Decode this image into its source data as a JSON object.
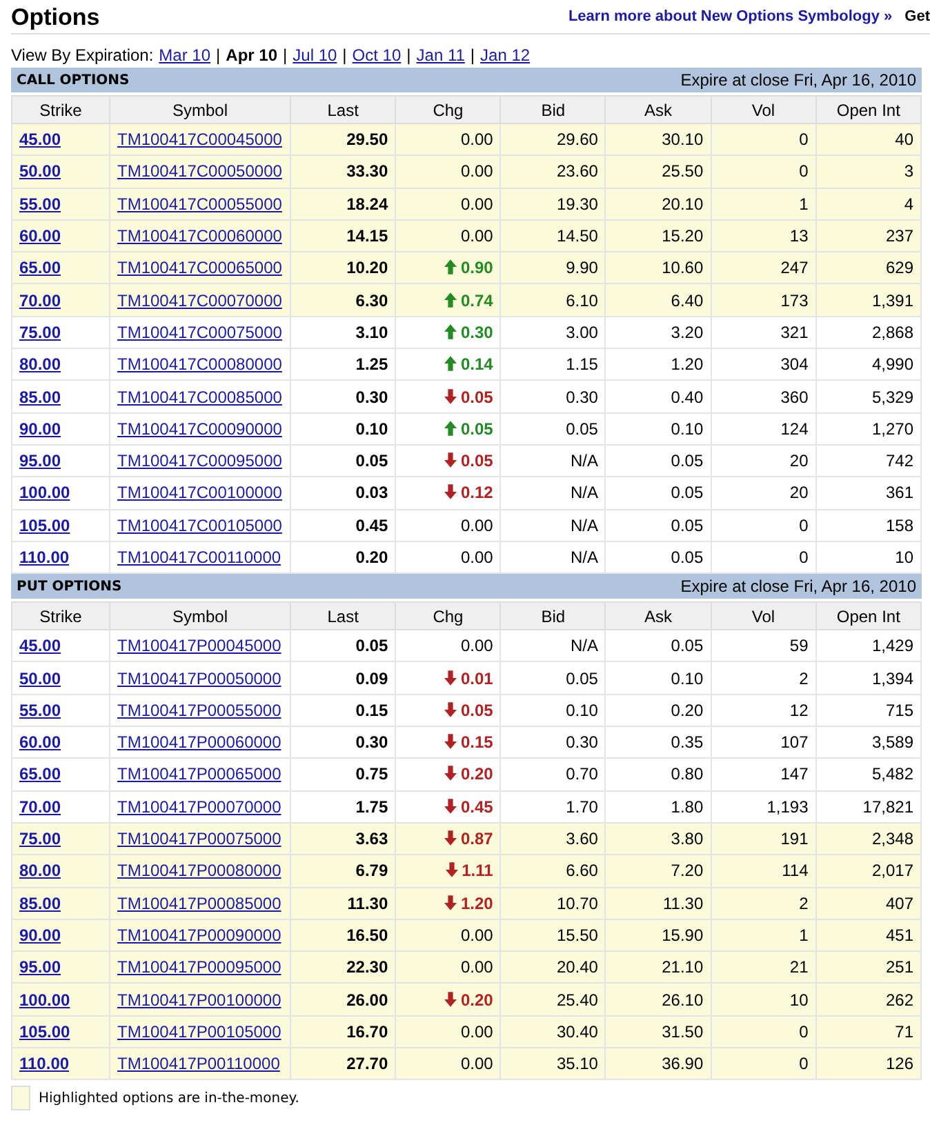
{
  "page_title": "Options",
  "symbology_link": "Learn more about New Options Symbology »",
  "get_link": "Get",
  "expiration": {
    "label": "View By Expiration:",
    "separator": "|",
    "options": [
      {
        "label": "Mar 10",
        "selected": false
      },
      {
        "label": "Apr 10",
        "selected": true
      },
      {
        "label": "Jul 10",
        "selected": false
      },
      {
        "label": "Oct 10",
        "selected": false
      },
      {
        "label": "Jan 11",
        "selected": false
      },
      {
        "label": "Jan 12",
        "selected": false
      }
    ]
  },
  "tables": [
    {
      "title": "CALL OPTIONS",
      "expire": "Expire at close Fri, Apr 16, 2010",
      "columns": [
        "Strike",
        "Symbol",
        "Last",
        "Chg",
        "Bid",
        "Ask",
        "Vol",
        "Open Int"
      ],
      "rows": [
        {
          "strike": "45.00",
          "symbol": "TM100417C00045000",
          "last": "29.50",
          "change": "0.00",
          "kind": "flat",
          "bid": "29.60",
          "ask": "30.10",
          "vol": "0",
          "open_int": "40",
          "in_the_money": true
        },
        {
          "strike": "50.00",
          "symbol": "TM100417C00050000",
          "last": "33.30",
          "change": "0.00",
          "kind": "flat",
          "bid": "23.60",
          "ask": "25.50",
          "vol": "0",
          "open_int": "3",
          "in_the_money": true
        },
        {
          "strike": "55.00",
          "symbol": "TM100417C00055000",
          "last": "18.24",
          "change": "0.00",
          "kind": "flat",
          "bid": "19.30",
          "ask": "20.10",
          "vol": "1",
          "open_int": "4",
          "in_the_money": true
        },
        {
          "strike": "60.00",
          "symbol": "TM100417C00060000",
          "last": "14.15",
          "change": "0.00",
          "kind": "flat",
          "bid": "14.50",
          "ask": "15.20",
          "vol": "13",
          "open_int": "237",
          "in_the_money": true
        },
        {
          "strike": "65.00",
          "symbol": "TM100417C00065000",
          "last": "10.20",
          "change": "0.90",
          "kind": "up",
          "bid": "9.90",
          "ask": "10.60",
          "vol": "247",
          "open_int": "629",
          "in_the_money": true
        },
        {
          "strike": "70.00",
          "symbol": "TM100417C00070000",
          "last": "6.30",
          "change": "0.74",
          "kind": "up",
          "bid": "6.10",
          "ask": "6.40",
          "vol": "173",
          "open_int": "1,391",
          "in_the_money": true
        },
        {
          "strike": "75.00",
          "symbol": "TM100417C00075000",
          "last": "3.10",
          "change": "0.30",
          "kind": "up",
          "bid": "3.00",
          "ask": "3.20",
          "vol": "321",
          "open_int": "2,868",
          "in_the_money": false
        },
        {
          "strike": "80.00",
          "symbol": "TM100417C00080000",
          "last": "1.25",
          "change": "0.14",
          "kind": "up",
          "bid": "1.15",
          "ask": "1.20",
          "vol": "304",
          "open_int": "4,990",
          "in_the_money": false
        },
        {
          "strike": "85.00",
          "symbol": "TM100417C00085000",
          "last": "0.30",
          "change": "0.05",
          "kind": "down",
          "bid": "0.30",
          "ask": "0.40",
          "vol": "360",
          "open_int": "5,329",
          "in_the_money": false
        },
        {
          "strike": "90.00",
          "symbol": "TM100417C00090000",
          "last": "0.10",
          "change": "0.05",
          "kind": "up",
          "bid": "0.05",
          "ask": "0.10",
          "vol": "124",
          "open_int": "1,270",
          "in_the_money": false
        },
        {
          "strike": "95.00",
          "symbol": "TM100417C00095000",
          "last": "0.05",
          "change": "0.05",
          "kind": "down",
          "bid": "N/A",
          "ask": "0.05",
          "vol": "20",
          "open_int": "742",
          "in_the_money": false
        },
        {
          "strike": "100.00",
          "symbol": "TM100417C00100000",
          "last": "0.03",
          "change": "0.12",
          "kind": "down",
          "bid": "N/A",
          "ask": "0.05",
          "vol": "20",
          "open_int": "361",
          "in_the_money": false
        },
        {
          "strike": "105.00",
          "symbol": "TM100417C00105000",
          "last": "0.45",
          "change": "0.00",
          "kind": "flat",
          "bid": "N/A",
          "ask": "0.05",
          "vol": "0",
          "open_int": "158",
          "in_the_money": false
        },
        {
          "strike": "110.00",
          "symbol": "TM100417C00110000",
          "last": "0.20",
          "change": "0.00",
          "kind": "flat",
          "bid": "N/A",
          "ask": "0.05",
          "vol": "0",
          "open_int": "10",
          "in_the_money": false
        }
      ]
    },
    {
      "title": "PUT OPTIONS",
      "expire": "Expire at close Fri, Apr 16, 2010",
      "columns": [
        "Strike",
        "Symbol",
        "Last",
        "Chg",
        "Bid",
        "Ask",
        "Vol",
        "Open Int"
      ],
      "rows": [
        {
          "strike": "45.00",
          "symbol": "TM100417P00045000",
          "last": "0.05",
          "change": "0.00",
          "kind": "flat",
          "bid": "N/A",
          "ask": "0.05",
          "vol": "59",
          "open_int": "1,429",
          "in_the_money": false
        },
        {
          "strike": "50.00",
          "symbol": "TM100417P00050000",
          "last": "0.09",
          "change": "0.01",
          "kind": "down",
          "bid": "0.05",
          "ask": "0.10",
          "vol": "2",
          "open_int": "1,394",
          "in_the_money": false
        },
        {
          "strike": "55.00",
          "symbol": "TM100417P00055000",
          "last": "0.15",
          "change": "0.05",
          "kind": "down",
          "bid": "0.10",
          "ask": "0.20",
          "vol": "12",
          "open_int": "715",
          "in_the_money": false
        },
        {
          "strike": "60.00",
          "symbol": "TM100417P00060000",
          "last": "0.30",
          "change": "0.15",
          "kind": "down",
          "bid": "0.30",
          "ask": "0.35",
          "vol": "107",
          "open_int": "3,589",
          "in_the_money": false
        },
        {
          "strike": "65.00",
          "symbol": "TM100417P00065000",
          "last": "0.75",
          "change": "0.20",
          "kind": "down",
          "bid": "0.70",
          "ask": "0.80",
          "vol": "147",
          "open_int": "5,482",
          "in_the_money": false
        },
        {
          "strike": "70.00",
          "symbol": "TM100417P00070000",
          "last": "1.75",
          "change": "0.45",
          "kind": "down",
          "bid": "1.70",
          "ask": "1.80",
          "vol": "1,193",
          "open_int": "17,821",
          "in_the_money": false
        },
        {
          "strike": "75.00",
          "symbol": "TM100417P00075000",
          "last": "3.63",
          "change": "0.87",
          "kind": "down",
          "bid": "3.60",
          "ask": "3.80",
          "vol": "191",
          "open_int": "2,348",
          "in_the_money": true
        },
        {
          "strike": "80.00",
          "symbol": "TM100417P00080000",
          "last": "6.79",
          "change": "1.11",
          "kind": "down",
          "bid": "6.60",
          "ask": "7.20",
          "vol": "114",
          "open_int": "2,017",
          "in_the_money": true
        },
        {
          "strike": "85.00",
          "symbol": "TM100417P00085000",
          "last": "11.30",
          "change": "1.20",
          "kind": "down",
          "bid": "10.70",
          "ask": "11.30",
          "vol": "2",
          "open_int": "407",
          "in_the_money": true
        },
        {
          "strike": "90.00",
          "symbol": "TM100417P00090000",
          "last": "16.50",
          "change": "0.00",
          "kind": "flat",
          "bid": "15.50",
          "ask": "15.90",
          "vol": "1",
          "open_int": "451",
          "in_the_money": true
        },
        {
          "strike": "95.00",
          "symbol": "TM100417P00095000",
          "last": "22.30",
          "change": "0.00",
          "kind": "flat",
          "bid": "20.40",
          "ask": "21.10",
          "vol": "21",
          "open_int": "251",
          "in_the_money": true
        },
        {
          "strike": "100.00",
          "symbol": "TM100417P00100000",
          "last": "26.00",
          "change": "0.20",
          "kind": "down",
          "bid": "25.40",
          "ask": "26.10",
          "vol": "10",
          "open_int": "262",
          "in_the_money": true
        },
        {
          "strike": "105.00",
          "symbol": "TM100417P00105000",
          "last": "16.70",
          "change": "0.00",
          "kind": "flat",
          "bid": "30.40",
          "ask": "31.50",
          "vol": "0",
          "open_int": "71",
          "in_the_money": true
        },
        {
          "strike": "110.00",
          "symbol": "TM100417P00110000",
          "last": "27.70",
          "change": "0.00",
          "kind": "flat",
          "bid": "35.10",
          "ask": "36.90",
          "vol": "0",
          "open_int": "126",
          "in_the_money": true
        }
      ]
    }
  ],
  "legend": "Highlighted options are in-the-money."
}
